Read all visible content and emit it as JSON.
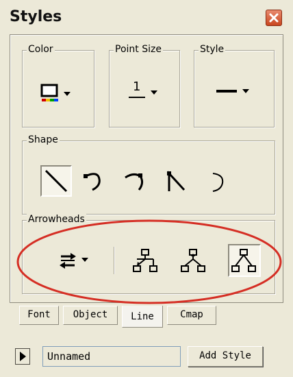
{
  "window": {
    "title": "Styles",
    "close_icon": "close-icon",
    "accent": "#d52e24"
  },
  "groups": {
    "color": {
      "label": "Color",
      "icon": "line-color-icon",
      "swatch_colors": [
        "#d00000",
        "#f0c000",
        "#00a000",
        "#0040ff"
      ]
    },
    "point_size": {
      "label": "Point Size",
      "value": "1"
    },
    "style": {
      "label": "Style",
      "icon": "solid-line-icon"
    },
    "shape": {
      "label": "Shape",
      "items": [
        {
          "name": "straight-line-shape-icon",
          "selected": true
        },
        {
          "name": "curved-left-shape-icon",
          "selected": false
        },
        {
          "name": "curved-right-shape-icon",
          "selected": false
        },
        {
          "name": "elbow-shape-icon",
          "selected": false
        },
        {
          "name": "arc-shape-icon",
          "selected": false
        }
      ]
    },
    "arrowheads": {
      "label": "Arrowheads",
      "items": [
        {
          "name": "arrow-direction-icon",
          "selected": false
        },
        {
          "name": "arrow-to-child-icon",
          "selected": false
        },
        {
          "name": "arrow-from-parent-icon",
          "selected": false
        },
        {
          "name": "no-arrow-tree-icon",
          "selected": true
        }
      ]
    }
  },
  "tabs": [
    {
      "label": "Font",
      "active": false
    },
    {
      "label": "Object",
      "active": false
    },
    {
      "label": "Line",
      "active": true
    },
    {
      "label": "Cmap",
      "active": false
    }
  ],
  "footer": {
    "play_icon": "play-icon",
    "style_name_value": "Unnamed",
    "add_style_label": "Add Style"
  }
}
